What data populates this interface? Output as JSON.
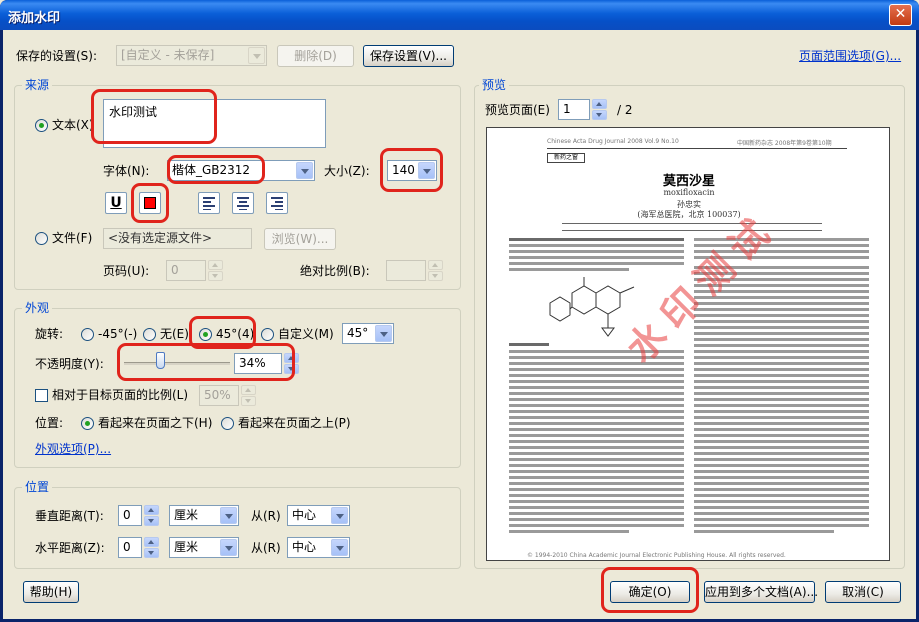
{
  "window": {
    "title": "添加水印",
    "close_glyph": "✕"
  },
  "top": {
    "saved_settings_label": "保存的设置(S):",
    "saved_settings_value": "[自定义 - 未保存]",
    "delete_label": "删除(D)",
    "save_settings_label": "保存设置(V)...",
    "page_range_label": "页面范围选项(G)..."
  },
  "source": {
    "group_title": "来源",
    "text_label": "文本(X)",
    "text_value": "水印测试",
    "font_label": "字体(N):",
    "font_value": "楷体_GB2312",
    "size_label": "大小(Z):",
    "size_value": "140",
    "underline_glyph": "U",
    "file_label": "文件(F)",
    "file_value": "<没有选定源文件>",
    "browse_label": "浏览(W)...",
    "page_num_label": "页码(U):",
    "page_num_value": "0",
    "abs_scale_label": "绝对比例(B):"
  },
  "appearance": {
    "group_title": "外观",
    "rotation_label": "旋转:",
    "rot_neg45": "-45°(-)",
    "rot_none": "无(E)",
    "rot_45": "45°(4)",
    "rot_custom": "自定义(M)",
    "rot_custom_value": "45°",
    "opacity_label": "不透明度(Y):",
    "opacity_value": "34%",
    "opacity_fraction": 0.34,
    "relative_scale_label": "相对于目标页面的比例(L)",
    "relative_scale_value": "50%",
    "position_label": "位置:",
    "pos_behind": "看起来在页面之下(H)",
    "pos_front": "看起来在页面之上(P)",
    "options_link": "外观选项(P)..."
  },
  "position": {
    "group_title": "位置",
    "vert_label": "垂直距离(T):",
    "vert_value": "0",
    "vert_unit": "厘米",
    "vert_from_label": "从(R)",
    "vert_from_value": "中心",
    "horiz_label": "水平距离(Z):",
    "horiz_value": "0",
    "horiz_unit": "厘米",
    "horiz_from_label": "从(R)",
    "horiz_from_value": "中心"
  },
  "preview": {
    "group_title": "预览",
    "page_label": "预览页面(E)",
    "page_value": "1",
    "page_total": "/ 2",
    "doc_header_left": "Chinese Acta Drug Journal 2008 Vol.9 No.10",
    "doc_header_right": "中国新药杂志 2008年第9卷第10期",
    "doc_section": "新药之窗",
    "doc_title": "莫西沙星",
    "doc_subtitle": "moxifloxacin",
    "doc_author": "孙忠实",
    "doc_affil": "(海军总医院，北京 100037)",
    "doc_footer": "© 1994-2010 China Academic Journal Electronic Publishing House. All rights reserved.",
    "watermark_text": "水印测试"
  },
  "bottom": {
    "help_label": "帮助(H)",
    "ok_label": "确定(O)",
    "apply_multi_label": "应用到多个文档(A)...",
    "cancel_label": "取消(C)"
  },
  "colors": {
    "highlight": "#e0241c",
    "watermark_color": "#ff0000",
    "group_title": "#0046d5",
    "titlebar": "#0a5fd8"
  }
}
